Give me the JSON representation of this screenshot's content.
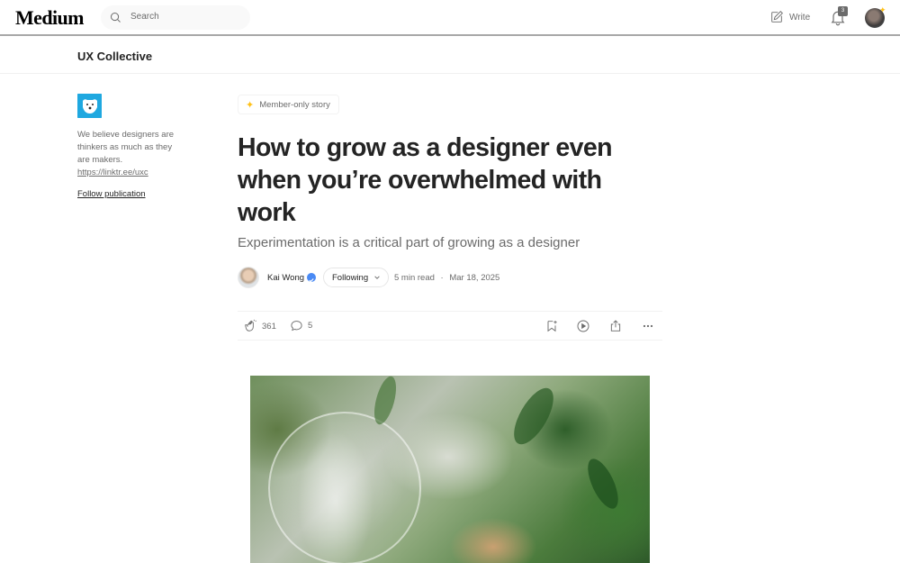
{
  "nav": {
    "logo": "Medium",
    "search_placeholder": "Search",
    "write_label": "Write",
    "notification_count": "3",
    "icons": {
      "search": "search-icon",
      "write": "pencil-square-icon",
      "notifications": "bell-icon"
    }
  },
  "publication": {
    "name": "UX Collective",
    "description": "We believe designers are thinkers as much as they are makers.",
    "link": "https://linktr.ee/uxc",
    "follow_label": "Follow publication"
  },
  "article": {
    "badge": "Member-only story",
    "title": "How to grow as a designer even when you’re overwhelmed with work",
    "subtitle": "Experimentation is a critical part of growing as a designer",
    "author": "Kai Wong",
    "follow_state": "Following",
    "read_time": "5 min read",
    "date": "Mar 18, 2025",
    "separator": "·"
  },
  "actions": {
    "claps": "361",
    "responses": "5"
  },
  "colors": {
    "accent_star": "#ffc017",
    "text_primary": "#242424",
    "text_secondary": "#6b6b6b",
    "publication_logo_bg": "#1fa8e0",
    "verified": "#4a8af4"
  }
}
